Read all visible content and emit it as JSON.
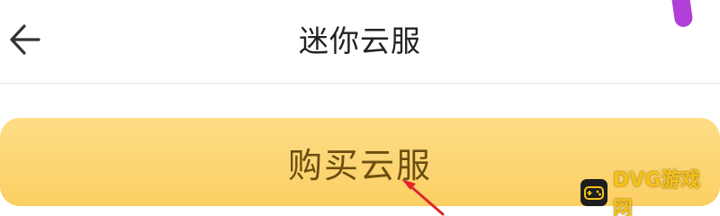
{
  "header": {
    "back_icon": "arrow-left-icon",
    "title": "迷你云服"
  },
  "main": {
    "buy_button_label": "购买云服"
  },
  "watermark": {
    "text": "DVG游戏网"
  },
  "colors": {
    "button_gradient_top": "#fddd86",
    "button_gradient_bottom": "#fbcf63",
    "button_text": "#6b4e10",
    "annotation_arrow": "#e0262d"
  }
}
